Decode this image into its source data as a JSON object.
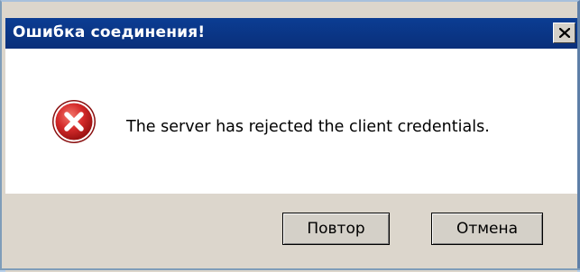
{
  "dialog": {
    "title": "Ошибка соединения!",
    "message": "The server has rejected the client credentials.",
    "icon": "error-icon",
    "close_icon": "close-icon"
  },
  "buttons": {
    "retry_label": "Повтор",
    "cancel_label": "Отмена"
  },
  "colors": {
    "titlebar": "#0b3d93",
    "content_bg": "#ffffff",
    "button_area_bg": "#dcd6cc",
    "error_red": "#d42a2a"
  }
}
